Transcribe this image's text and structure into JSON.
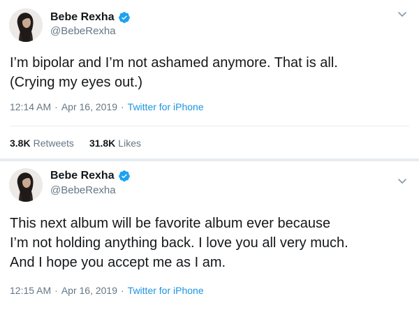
{
  "colors": {
    "text": "#14171a",
    "secondary": "#657786",
    "link": "#1b95e0",
    "verified": "#1da1f2",
    "separator": "#e6ecf0"
  },
  "tweets": [
    {
      "author_name": "Bebe Rexha",
      "handle": "@BebeRexha",
      "verified": true,
      "text": "I’m bipolar and I’m not ashamed anymore. That is all.\n(Crying my eyes out.)",
      "time": "12:14 AM",
      "date": "Apr 16, 2019",
      "source": "Twitter for iPhone",
      "retweets_count": "3.8K",
      "retweets_label": "Retweets",
      "likes_count": "31.8K",
      "likes_label": "Likes"
    },
    {
      "author_name": "Bebe Rexha",
      "handle": "@BebeRexha",
      "verified": true,
      "text": "This next album will be favorite album ever because\nI’m not holding anything back. I love you all very much.\nAnd I hope you accept me as I am.",
      "time": "12:15 AM",
      "date": "Apr 16, 2019",
      "source": "Twitter for iPhone"
    }
  ],
  "separator_char": "·",
  "icons": {
    "verified": "verified-badge-icon",
    "more": "chevron-down-icon"
  }
}
